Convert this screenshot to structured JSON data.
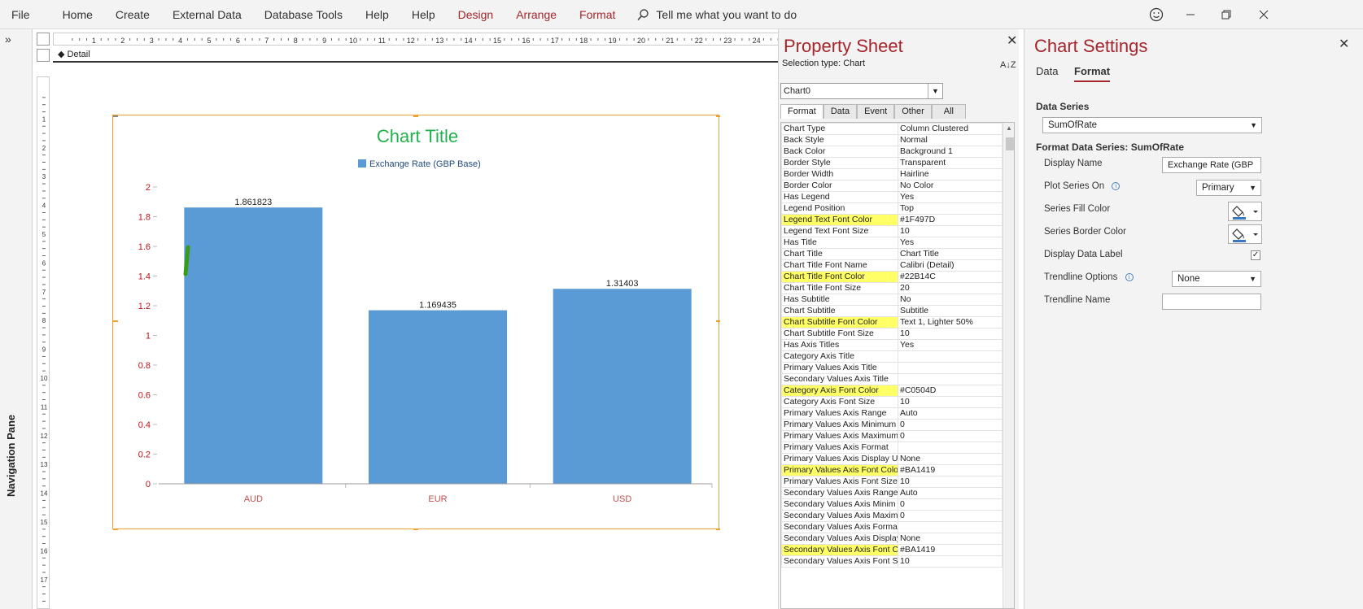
{
  "ribbon": {
    "tabs": [
      "File",
      "Home",
      "Create",
      "External Data",
      "Database Tools",
      "Help",
      "Help"
    ],
    "context_tabs": [
      "Design",
      "Arrange",
      "Format"
    ],
    "tell_me": "Tell me what you want to do"
  },
  "nav_pane": {
    "label": "Navigation Pane",
    "expand_glyph": "»"
  },
  "design": {
    "section_label": "Detail",
    "ruler_numbers": [
      "1",
      "2",
      "3",
      "4",
      "5",
      "6",
      "7",
      "8",
      "9",
      "10",
      "11",
      "12",
      "13",
      "14",
      "15",
      "16",
      "17",
      "18",
      "19",
      "20",
      "21",
      "22",
      "23",
      "24"
    ],
    "left_ruler_numbers": [
      "1",
      "2",
      "3",
      "4",
      "5",
      "6",
      "7",
      "8",
      "9",
      "10",
      "11",
      "12",
      "13",
      "14",
      "15",
      "16",
      "17"
    ]
  },
  "chart_data": {
    "type": "bar",
    "title": "Chart Title",
    "title_color": "#22B14C",
    "legend": [
      {
        "name": "Exchange Rate (GBP Base)",
        "color": "#5B9BD5"
      }
    ],
    "legend_text_color": "#1F497D",
    "categories": [
      "AUD",
      "EUR",
      "USD"
    ],
    "category_axis_color": "#C0504D",
    "value_axis_color": "#BA1419",
    "series": [
      {
        "name": "Exchange Rate (GBP Base)",
        "values": [
          1.861823,
          1.169435,
          1.31403
        ],
        "labels": [
          "1.861823",
          "1.169435",
          "1.31403"
        ],
        "color": "#5B9BD5"
      }
    ],
    "yticks": [
      "0",
      "0.2",
      "0.4",
      "0.6",
      "0.8",
      "1",
      "1.2",
      "1.4",
      "1.6",
      "1.8",
      "2"
    ],
    "ylim": [
      0,
      2
    ],
    "legend_position": "top"
  },
  "property_sheet": {
    "title": "Property Sheet",
    "selection_type": "Selection type:  Chart",
    "sort_glyph": "A↓Z",
    "object": "Chart0",
    "tabs": [
      "Format",
      "Data",
      "Event",
      "Other",
      "All"
    ],
    "rows": [
      [
        "Chart Type",
        "Column Clustered",
        false
      ],
      [
        "Back Style",
        "Normal",
        false
      ],
      [
        "Back Color",
        "Background 1",
        false
      ],
      [
        "Border Style",
        "Transparent",
        false
      ],
      [
        "Border Width",
        "Hairline",
        false
      ],
      [
        "Border Color",
        "No Color",
        false
      ],
      [
        "Has Legend",
        "Yes",
        false
      ],
      [
        "Legend Position",
        "Top",
        false
      ],
      [
        "Legend Text Font Color",
        "#1F497D",
        true
      ],
      [
        "Legend Text Font Size",
        "10",
        false
      ],
      [
        "Has Title",
        "Yes",
        false
      ],
      [
        "Chart Title",
        "Chart Title",
        false
      ],
      [
        "Chart Title Font Name",
        "Calibri (Detail)",
        false
      ],
      [
        "Chart Title Font Color",
        "#22B14C",
        true
      ],
      [
        "Chart Title Font Size",
        "20",
        false
      ],
      [
        "Has Subtitle",
        "No",
        false
      ],
      [
        "Chart Subtitle",
        "Subtitle",
        false
      ],
      [
        "Chart Subtitle Font Color",
        "Text 1, Lighter 50%",
        true
      ],
      [
        "Chart Subtitle Font Size",
        "10",
        false
      ],
      [
        "Has Axis Titles",
        "Yes",
        false
      ],
      [
        "Category Axis Title",
        "",
        false
      ],
      [
        "Primary Values Axis Title",
        "",
        false
      ],
      [
        "Secondary Values Axis Title",
        "",
        false
      ],
      [
        "Category Axis Font Color",
        "#C0504D",
        true
      ],
      [
        "Category Axis Font Size",
        "10",
        false
      ],
      [
        "Primary Values Axis Range",
        "Auto",
        false
      ],
      [
        "Primary Values Axis Minimum",
        "0",
        false
      ],
      [
        "Primary Values Axis Maximum",
        "0",
        false
      ],
      [
        "Primary Values Axis Format",
        "",
        false
      ],
      [
        "Primary Values Axis Display U",
        "None",
        false
      ],
      [
        "Primary Values Axis Font Colo",
        "#BA1419",
        true
      ],
      [
        "Primary Values Axis Font Size",
        "10",
        false
      ],
      [
        "Secondary Values Axis Range",
        "Auto",
        false
      ],
      [
        "Secondary Values Axis Minim",
        "0",
        false
      ],
      [
        "Secondary Values Axis Maxim",
        "0",
        false
      ],
      [
        "Secondary Values Axis Forma",
        "",
        false
      ],
      [
        "Secondary Values Axis Display",
        "None",
        false
      ],
      [
        "Secondary Values Axis Font C",
        "#BA1419",
        true
      ],
      [
        "Secondary Values Axis Font S",
        "10",
        false
      ]
    ]
  },
  "chart_settings": {
    "title": "Chart Settings",
    "tabs": [
      "Data",
      "Format"
    ],
    "data_series_label": "Data Series",
    "data_series_value": "SumOfRate",
    "format_series_label": "Format Data Series: SumOfRate",
    "display_name_label": "Display Name",
    "display_name_value": "Exchange Rate (GBP",
    "plot_series_label": "Plot Series On",
    "plot_series_value": "Primary",
    "fill_color_label": "Series Fill Color",
    "border_color_label": "Series Border Color",
    "data_label_label": "Display Data Label",
    "trendline_options_label": "Trendline Options",
    "trendline_options_value": "None",
    "trendline_name_label": "Trendline Name",
    "fill_swatch": "#3A78C2"
  }
}
